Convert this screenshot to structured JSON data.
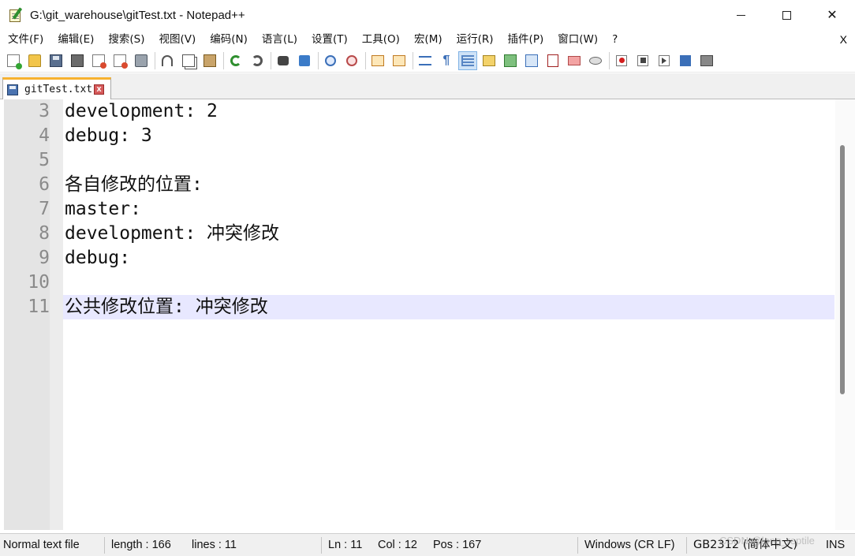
{
  "window": {
    "title": "G:\\git_warehouse\\gitTest.txt - Notepad++",
    "minimize": "",
    "maximize": "",
    "close": "✕"
  },
  "menu": {
    "items": [
      "文件(F)",
      "编辑(E)",
      "搜索(S)",
      "视图(V)",
      "编码(N)",
      "语言(L)",
      "设置(T)",
      "工具(O)",
      "宏(M)",
      "运行(R)",
      "插件(P)",
      "窗口(W)",
      "?"
    ],
    "close_doc": "X"
  },
  "toolbar": {
    "buttons": [
      "new-file-icon",
      "open-file-icon",
      "save-icon",
      "save-all-icon",
      "close-icon",
      "close-all-icon",
      "print-icon",
      "cut-icon",
      "copy-icon",
      "paste-icon",
      "undo-icon",
      "redo-icon",
      "find-icon",
      "replace-icon",
      "zoom-in-icon",
      "zoom-out-icon",
      "sync-vertical-icon",
      "sync-horizontal-icon",
      "word-wrap-icon",
      "show-all-chars-icon",
      "indent-guide-icon",
      "define-language-icon",
      "document-map-icon",
      "document-list-icon",
      "function-list-icon",
      "folder-workspace-icon",
      "monitoring-icon",
      "macro-record-icon",
      "macro-stop-icon",
      "macro-play-icon",
      "macro-run-multiple-icon",
      "macro-save-icon"
    ],
    "active_button": "indent-guide-icon"
  },
  "tab": {
    "label": "gitTest.txt",
    "close": "x"
  },
  "editor": {
    "lines": [
      {
        "num": "3",
        "text": "development: 2"
      },
      {
        "num": "4",
        "text": "debug: 3"
      },
      {
        "num": "5",
        "text": ""
      },
      {
        "num": "6",
        "text": "各自修改的位置:"
      },
      {
        "num": "7",
        "text": "master:"
      },
      {
        "num": "8",
        "text": "development: 冲突修改"
      },
      {
        "num": "9",
        "text": "debug:"
      },
      {
        "num": "10",
        "text": ""
      },
      {
        "num": "11",
        "text": "公共修改位置: 冲突修改"
      }
    ],
    "current_line": "11",
    "current_line_color": "#e8e8ff"
  },
  "status": {
    "file_type": "Normal text file",
    "length": "length : 166",
    "lines": "lines : 11",
    "ln": "Ln : 11",
    "col": "Col : 12",
    "pos": "Pos : 167",
    "eol": "Windows (CR LF)",
    "encoding": "GB2312 (简体中文)",
    "mode": "INS",
    "watermark": "CSDN @long_reptile"
  }
}
